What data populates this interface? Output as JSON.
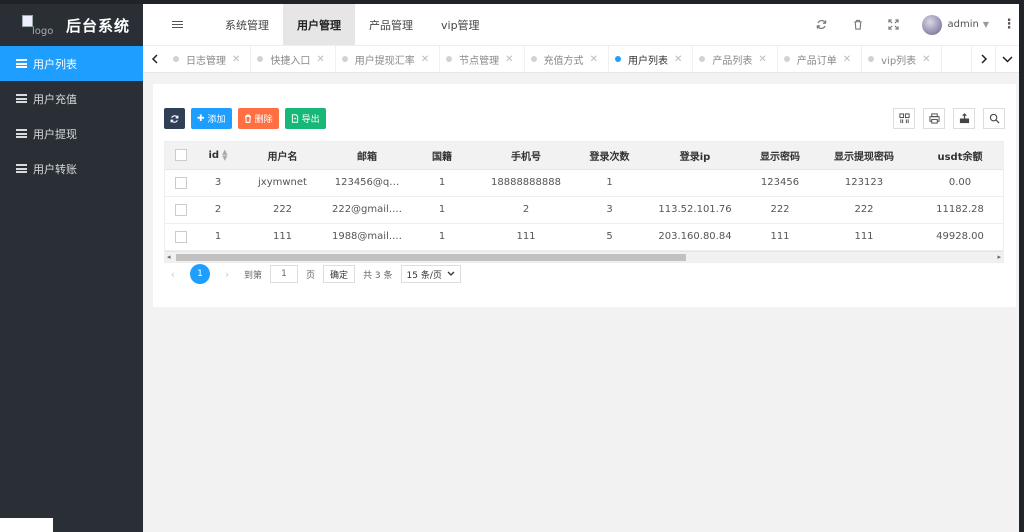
{
  "app": {
    "logo_alt": "logo",
    "title": "后台系统"
  },
  "sidebar": {
    "items": [
      {
        "label": "用户列表",
        "active": true
      },
      {
        "label": "用户充值",
        "active": false
      },
      {
        "label": "用户提现",
        "active": false
      },
      {
        "label": "用户转账",
        "active": false
      }
    ]
  },
  "header": {
    "menu": [
      {
        "label": "系统管理",
        "active": false
      },
      {
        "label": "用户管理",
        "active": true
      },
      {
        "label": "产品管理",
        "active": false
      },
      {
        "label": "vip管理",
        "active": false
      }
    ],
    "user": "admin"
  },
  "tabs": [
    {
      "label": "日志管理",
      "active": false
    },
    {
      "label": "快捷入口",
      "active": false
    },
    {
      "label": "用户提现汇率",
      "active": false
    },
    {
      "label": "节点管理",
      "active": false
    },
    {
      "label": "充值方式",
      "active": false
    },
    {
      "label": "用户列表",
      "active": true
    },
    {
      "label": "产品列表",
      "active": false
    },
    {
      "label": "产品订单",
      "active": false
    },
    {
      "label": "vip列表",
      "active": false
    }
  ],
  "toolbar": {
    "add_label": "添加",
    "delete_label": "删除",
    "export_label": "导出"
  },
  "table": {
    "columns": [
      "id",
      "用户名",
      "邮箱",
      "国籍",
      "手机号",
      "登录次数",
      "登录ip",
      "显示密码",
      "显示提现密码",
      "usdt余额"
    ],
    "rows": [
      [
        "3",
        "jxymwnet",
        "123456@q…",
        "1",
        "18888888888",
        "1",
        "",
        "123456",
        "123123",
        "0.00"
      ],
      [
        "2",
        "222",
        "222@gmail.…",
        "1",
        "2",
        "3",
        "113.52.101.76",
        "222",
        "222",
        "11182.28"
      ],
      [
        "1",
        "111",
        "1988@mail.…",
        "1",
        "111",
        "5",
        "203.160.80.84",
        "111",
        "111",
        "49928.00"
      ]
    ]
  },
  "pager": {
    "current": "1",
    "goto_label": "到第",
    "goto_value": "1",
    "page_unit": "页",
    "confirm": "确定",
    "total": "共 3 条",
    "page_size": "15 条/页"
  }
}
